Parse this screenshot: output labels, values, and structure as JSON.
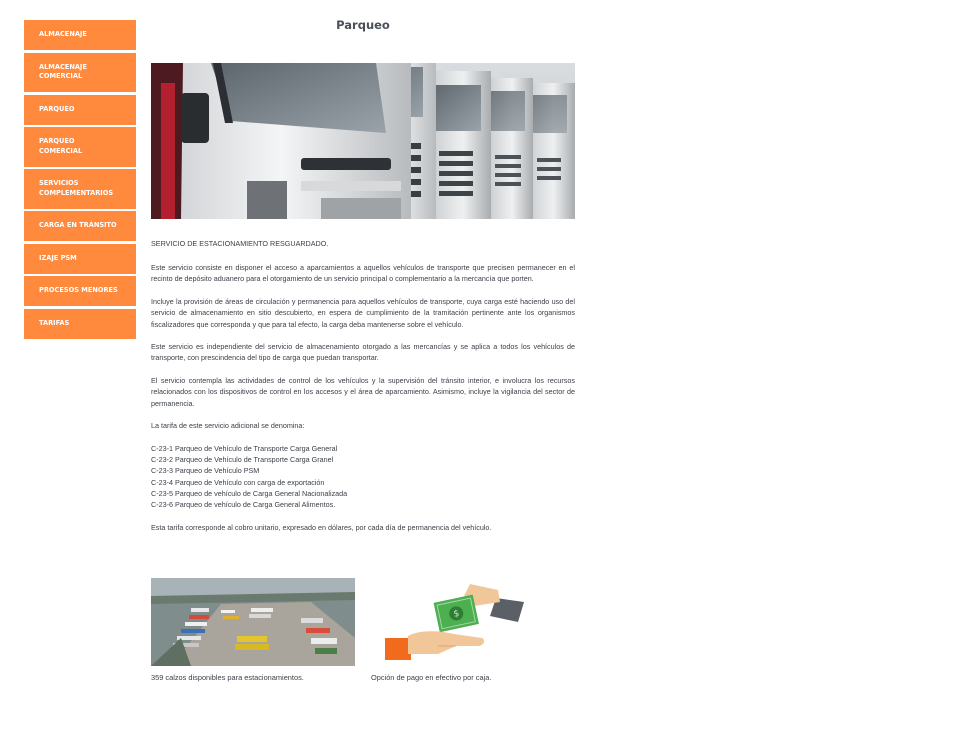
{
  "sidebar": {
    "items": [
      {
        "lines": [
          "ALMACENAJE"
        ]
      },
      {
        "lines": [
          "ALMACENAJE",
          "COMERCIAL"
        ]
      },
      {
        "lines": [
          "PARQUEO"
        ]
      },
      {
        "lines": [
          "PARQUEO",
          "COMERCIAL"
        ]
      },
      {
        "lines": [
          "SERVICIOS",
          "COMPLEMENTARIOS"
        ]
      },
      {
        "lines": [
          "CARGA EN TRÁNSITO"
        ]
      },
      {
        "lines": [
          "IZAJE PSM"
        ]
      },
      {
        "lines": [
          "PROCESOS MENORES"
        ]
      },
      {
        "lines": [
          "TARIFAS"
        ]
      }
    ]
  },
  "page": {
    "title": "Parqueo"
  },
  "content": {
    "heading": "SERVICIO DE ESTACIONAMIENTO RESGUARDADO.",
    "p1": "Este servicio consiste en disponer el acceso a aparcamientos a aquellos vehículos de transporte que precisen permanecer en el recinto de depósito aduanero para el otorgamiento de un servicio principal o complementario a la mercancía que porten.",
    "p2": "Incluye la provisión de áreas de circulación y permanencia para aquellos vehículos de transporte, cuya carga esté haciendo uso del servicio de almacenamiento en sitio descubierto, en espera de cumplimiento de la tramitación pertinente ante los organismos fiscalizadores que corresponda y que para tal efecto, la carga deba mantenerse sobre el vehículo.",
    "p3": "Este servicio es independiente del servicio de almacenamiento otorgado a las mercancías y se aplica a todos los vehículos de transporte, con prescindencia del tipo de carga que puedan transportar.",
    "p4": "El servicio contempla las actividades de control de los vehículos y la supervisión del tránsito interior, e involucra los recursos relacionados con los dispositivos de control en los accesos y el área de aparcamiento. Asimismo, incluye la vigilancia del sector de permanencia.",
    "p5": "La tarifa de este servicio adicional se denomina:",
    "codes": [
      "C-23-1 Parqueo de Vehículo de Transporte Carga General",
      "C-23-2 Parqueo de Vehículo de Transporte Carga Granel",
      "C-23-3 Parqueo de Vehículo PSM",
      "C-23-4 Parqueo de Vehículo con carga de exportación",
      "C-23-5 Parqueo de vehículo de Carga General Nacionalizada",
      "C-23-6 Parqueo de vehículo de Carga General Alimentos."
    ],
    "p6": "Esta tarifa corresponde al cobro unitario, expresado en dólares, por cada día de permanencia del vehículo."
  },
  "captions": {
    "lot": "359 calzos disponibles para estacionamientos.",
    "payment": "Opción de pago en efectivo por caja."
  },
  "colors": {
    "accent": "#ff8a3d",
    "title": "#4a5059",
    "text": "#3a3f48"
  },
  "images": {
    "hero": "trucks-photo",
    "lot": "parking-lot-aerial-photo",
    "payment": "cash-payment-illustration"
  }
}
